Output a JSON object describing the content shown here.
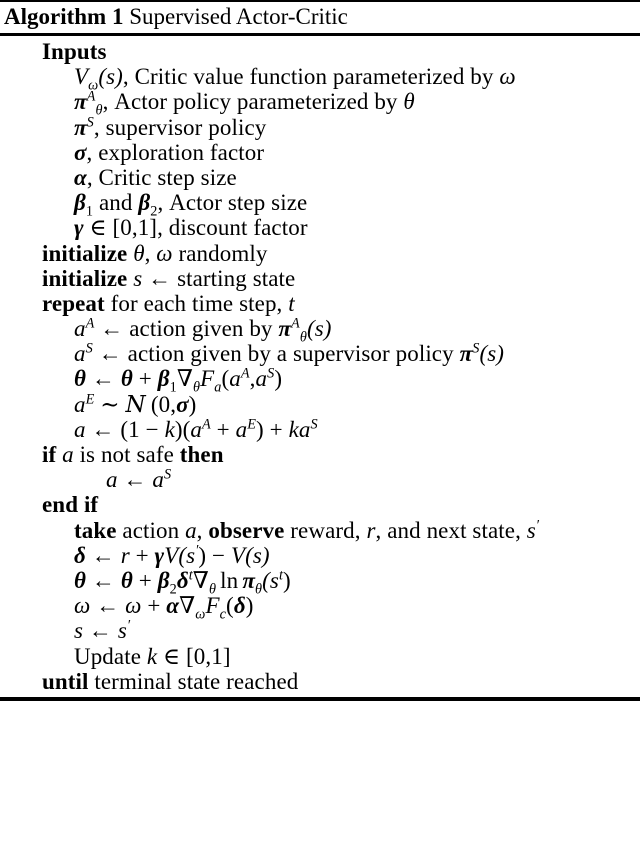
{
  "document": {
    "type": "algorithm-pseudocode",
    "title_keyword": "Algorithm 1",
    "title_text": "Supervised Actor-Critic"
  },
  "lines": {
    "inputs_header": "Inputs",
    "input_critic": {
      "symbol": "V",
      "symbol_sub": "ω",
      "symbol_arg": "(s)",
      "text": ", Critic value function parameterized by ",
      "param": "ω"
    },
    "input_actor": {
      "symbol": "π",
      "symbol_sup": "A",
      "symbol_sub": "θ",
      "text": ", Actor policy parameterized by ",
      "param": "θ"
    },
    "input_supervisor": {
      "symbol": "π",
      "symbol_sup": "S",
      "text": ", supervisor policy"
    },
    "input_sigma": {
      "symbol": "σ",
      "text": ", exploration factor"
    },
    "input_alpha": {
      "symbol": "α",
      "text": ", Critic step size"
    },
    "input_beta": {
      "symbol1": "β",
      "sub1": "1",
      "conj": " and ",
      "symbol2": "β",
      "sub2": "2",
      "text": ", Actor step size"
    },
    "input_gamma": {
      "symbol": "γ",
      "relation": " ∈ [0,1]",
      "text": ", discount factor"
    },
    "init_params": {
      "keyword": "initialize",
      "sym1": "θ",
      "comma": ", ",
      "sym2": "ω",
      "text": " randomly"
    },
    "init_state": {
      "keyword": "initialize",
      "sym": "s",
      "arrow": " ← ",
      "text": "starting state"
    },
    "repeat": {
      "keyword": "repeat",
      "text": " for each time step, ",
      "var": "t"
    },
    "actor_action": {
      "lhs": "a",
      "lhs_sup": "A",
      "arrow": " ← ",
      "text": "action given by ",
      "policy": "π",
      "policy_sup": "A",
      "policy_sub": "θ",
      "policy_arg": "(s)"
    },
    "supervisor_action": {
      "lhs": "a",
      "lhs_sup": "S",
      "arrow": " ← ",
      "text": "action given by a supervisor policy ",
      "policy": "π",
      "policy_sup": "S",
      "policy_arg": "(s)"
    },
    "theta_update_1": {
      "lhs": "θ",
      "arrow": " ← ",
      "rhs_sym": "θ",
      "plus": " + ",
      "beta": "β",
      "beta_sub": "1",
      "nabla": "∇",
      "nabla_sub": "θ",
      "func": "F",
      "func_sub": "a",
      "args_open": "(",
      "arg1": "a",
      "arg1_sup": "A",
      "arg_sep": ",",
      "arg2": "a",
      "arg2_sup": "S",
      "args_close": ")"
    },
    "exploration_noise": {
      "lhs": "a",
      "lhs_sup": "E",
      "dist": " ∼ ",
      "normal": "N",
      "params": "(0,",
      "sigma": "σ",
      "close": ")"
    },
    "action_mix": {
      "lhs": "a",
      "arrow": " ← ",
      "expr_a": "(1 − ",
      "k1": "k",
      "expr_b": ")(",
      "aA": "a",
      "aA_sup": "A",
      "plus1": " + ",
      "aE": "a",
      "aE_sup": "E",
      "expr_c": ") + ",
      "k2": "k",
      "aS": "a",
      "aS_sup": "S"
    },
    "if_safe": {
      "keyword_if": "if",
      "var": "a",
      "text": " is not safe ",
      "keyword_then": "then"
    },
    "safe_fallback": {
      "lhs": "a",
      "arrow": " ← ",
      "rhs": "a",
      "rhs_sup": "S"
    },
    "end_if": "end if",
    "take_action": {
      "keyword_take": "take",
      "text1": " action ",
      "action_var": "a",
      "text2": ", ",
      "keyword_observe": "observe",
      "text3": " reward, ",
      "reward_var": "r",
      "text4": ", and next state, ",
      "state_var": "s",
      "state_prime": "′"
    },
    "td_error": {
      "lhs": "δ",
      "arrow": " ← ",
      "r": "r",
      "plus": " + ",
      "gamma": "γ",
      "V1": "V",
      "arg1": "(s",
      "prime": "′",
      "arg1_close": ")",
      "minus": " − ",
      "V2": "V",
      "arg2": "(s)"
    },
    "theta_update_2": {
      "lhs": "θ",
      "arrow": " ← ",
      "rhs_sym": "θ",
      "plus": " + ",
      "beta": "β",
      "beta_sub": "2",
      "delta": "δ",
      "delta_sup": "t",
      "nabla": "∇",
      "nabla_sub": "θ",
      "ln": "ln",
      "pi": "π",
      "pi_sub": "θ",
      "arg_open": "(s",
      "arg_sup": "t",
      "arg_close": ")"
    },
    "omega_update": {
      "lhs": "ω",
      "arrow": " ← ",
      "rhs_sym": "ω",
      "plus": " + ",
      "alpha": "α",
      "nabla": "∇",
      "nabla_sub": "ω",
      "func": "F",
      "func_sub": "c",
      "arg_open": "(",
      "delta": "δ",
      "arg_close": ")"
    },
    "state_advance": {
      "lhs": "s",
      "arrow": " ← ",
      "rhs": "s",
      "rhs_prime": "′"
    },
    "update_k": {
      "text": "Update ",
      "var": "k",
      "relation": " ∈ [0,1]"
    },
    "until": {
      "keyword": "until",
      "text": " terminal state reached"
    }
  }
}
